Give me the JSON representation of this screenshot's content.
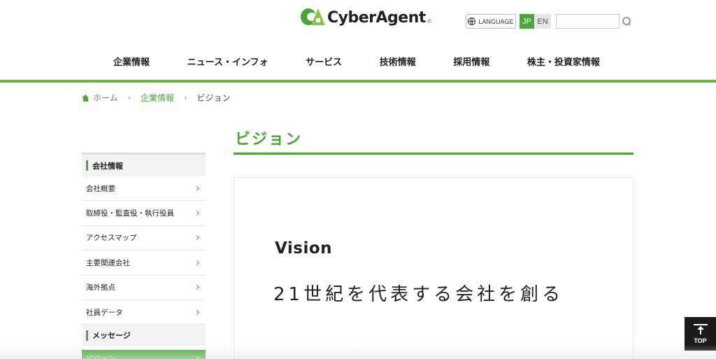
{
  "header": {
    "logo_text": "CyberAgent",
    "logo_dot": "®",
    "language_label": "LANGUAGE",
    "lang_jp": "JP",
    "lang_en": "EN",
    "search_value": "",
    "nav": [
      {
        "label": "企業情報"
      },
      {
        "label": "ニュース・インフォ"
      },
      {
        "label": "サービス"
      },
      {
        "label": "技術情報"
      },
      {
        "label": "採用情報"
      },
      {
        "label": "株主・投資家情報"
      }
    ]
  },
  "breadcrumb": {
    "home": "ホーム",
    "sep": "›",
    "company": "企業情報",
    "current": "ビジョン"
  },
  "sidebar": {
    "section1": "会社情報",
    "items": [
      {
        "label": "会社概要"
      },
      {
        "label": "取締役・監査役・執行役員"
      },
      {
        "label": "アクセスマップ"
      },
      {
        "label": "主要関連会社"
      },
      {
        "label": "海外拠点"
      },
      {
        "label": "社員データ"
      }
    ],
    "section2": "メッセージ",
    "active_item": "ビジョン"
  },
  "main": {
    "title": "ビジョン",
    "vision_label": "Vision",
    "vision_text": "21世紀を代表する会社を創る"
  },
  "top_button": {
    "label": "TOP"
  },
  "colors": {
    "brand_green": "#4aa63a",
    "nav_line": "#6ab640"
  }
}
